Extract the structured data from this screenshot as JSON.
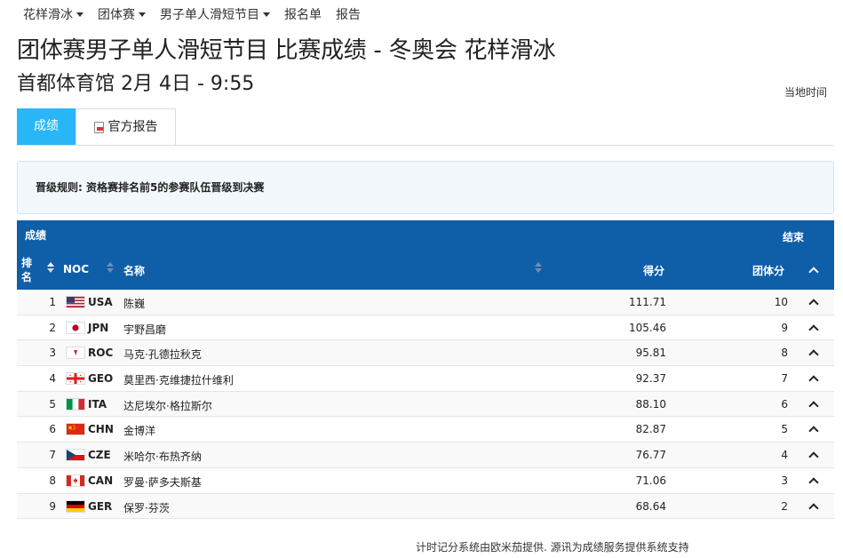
{
  "nav": {
    "items": [
      {
        "label": "花样滑冰",
        "dropdown": true
      },
      {
        "label": "团体赛",
        "dropdown": true
      },
      {
        "label": "男子单人滑短节目",
        "dropdown": true
      },
      {
        "label": "报名单",
        "dropdown": false
      },
      {
        "label": "报告",
        "dropdown": false
      }
    ]
  },
  "header": {
    "title": "团体赛男子单人滑短节目 比赛成绩 - 冬奥会 花样滑冰",
    "subtitle": "首都体育馆 2月 4日 - 9:55",
    "local_time": "当地时间"
  },
  "tabs": {
    "results": "成绩",
    "report": "官方报告"
  },
  "rules": {
    "text": "晋级规则: 资格赛排名前5的参赛队伍晋级到决赛"
  },
  "table": {
    "title": "成绩",
    "status": "结束",
    "columns": {
      "rank": "排名",
      "noc": "NOC",
      "name": "名称",
      "score": "得分",
      "team_points": "团体分"
    },
    "rows": [
      {
        "rank": "1",
        "noc": "USA",
        "name": "陈巍",
        "score": "111.71",
        "team_points": "10"
      },
      {
        "rank": "2",
        "noc": "JPN",
        "name": "宇野昌磨",
        "score": "105.46",
        "team_points": "9"
      },
      {
        "rank": "3",
        "noc": "ROC",
        "name": "马克·孔德拉秋克",
        "score": "95.81",
        "team_points": "8"
      },
      {
        "rank": "4",
        "noc": "GEO",
        "name": "莫里西·克维捷拉什维利",
        "score": "92.37",
        "team_points": "7"
      },
      {
        "rank": "5",
        "noc": "ITA",
        "name": "达尼埃尔·格拉斯尔",
        "score": "88.10",
        "team_points": "6"
      },
      {
        "rank": "6",
        "noc": "CHN",
        "name": "金博洋",
        "score": "82.87",
        "team_points": "5"
      },
      {
        "rank": "7",
        "noc": "CZE",
        "name": "米哈尔·布热齐纳",
        "score": "76.77",
        "team_points": "4"
      },
      {
        "rank": "8",
        "noc": "CAN",
        "name": "罗曼·萨多夫斯基",
        "score": "71.06",
        "team_points": "3"
      },
      {
        "rank": "9",
        "noc": "GER",
        "name": "保罗·芬茨",
        "score": "68.64",
        "team_points": "2"
      }
    ]
  },
  "footer": {
    "text": "计时记分系统由欧米茄提供. 源讯为成绩服务提供系统支持"
  },
  "colors": {
    "header_blue": "#0f5ea8",
    "tab_active": "#29b6f6",
    "rules_bg": "#f2f8fc"
  }
}
